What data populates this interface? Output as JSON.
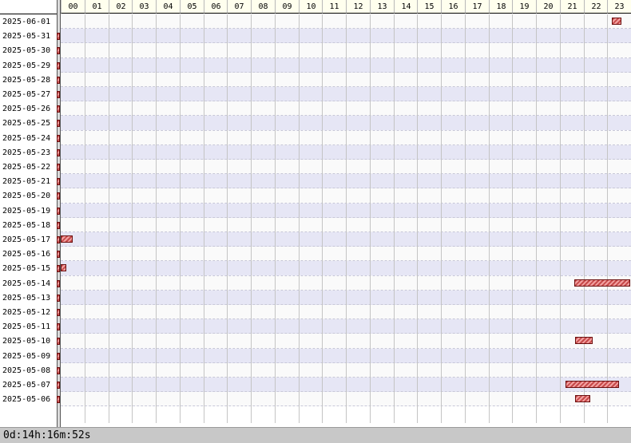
{
  "hours": [
    "00",
    "01",
    "02",
    "03",
    "04",
    "05",
    "06",
    "07",
    "08",
    "09",
    "10",
    "11",
    "12",
    "13",
    "14",
    "15",
    "16",
    "17",
    "18",
    "19",
    "20",
    "21",
    "22",
    "23"
  ],
  "rows": [
    {
      "date": "2025-06-01",
      "bars": [
        {
          "start": 23.2,
          "end": 23.6
        }
      ]
    },
    {
      "date": "2025-05-31",
      "bars": []
    },
    {
      "date": "2025-05-30",
      "bars": []
    },
    {
      "date": "2025-05-29",
      "bars": []
    },
    {
      "date": "2025-05-28",
      "bars": []
    },
    {
      "date": "2025-05-27",
      "bars": []
    },
    {
      "date": "2025-05-26",
      "bars": []
    },
    {
      "date": "2025-05-25",
      "bars": []
    },
    {
      "date": "2025-05-24",
      "bars": []
    },
    {
      "date": "2025-05-23",
      "bars": []
    },
    {
      "date": "2025-05-22",
      "bars": []
    },
    {
      "date": "2025-05-21",
      "bars": []
    },
    {
      "date": "2025-05-20",
      "bars": []
    },
    {
      "date": "2025-05-19",
      "bars": []
    },
    {
      "date": "2025-05-18",
      "bars": []
    },
    {
      "date": "2025-05-17",
      "bars": [
        {
          "start": 0.0,
          "end": 0.5
        }
      ]
    },
    {
      "date": "2025-05-16",
      "bars": []
    },
    {
      "date": "2025-05-15",
      "bars": [
        {
          "start": 0.0,
          "end": 0.25
        }
      ]
    },
    {
      "date": "2025-05-14",
      "bars": [
        {
          "start": 21.6,
          "end": 24.0
        }
      ]
    },
    {
      "date": "2025-05-13",
      "bars": []
    },
    {
      "date": "2025-05-12",
      "bars": []
    },
    {
      "date": "2025-05-11",
      "bars": []
    },
    {
      "date": "2025-05-10",
      "bars": [
        {
          "start": 21.65,
          "end": 22.4
        }
      ]
    },
    {
      "date": "2025-05-09",
      "bars": []
    },
    {
      "date": "2025-05-08",
      "bars": []
    },
    {
      "date": "2025-05-07",
      "bars": [
        {
          "start": 21.25,
          "end": 23.5
        }
      ]
    },
    {
      "date": "2025-05-06",
      "bars": [
        {
          "start": 21.65,
          "end": 22.3
        }
      ]
    }
  ],
  "status": {
    "total_duration": "0d:14h:16m:52s"
  },
  "colors": {
    "bar_fill": "#c64a4a",
    "row_alt": "#e6e6f5",
    "header_bg": "#ffffee"
  }
}
